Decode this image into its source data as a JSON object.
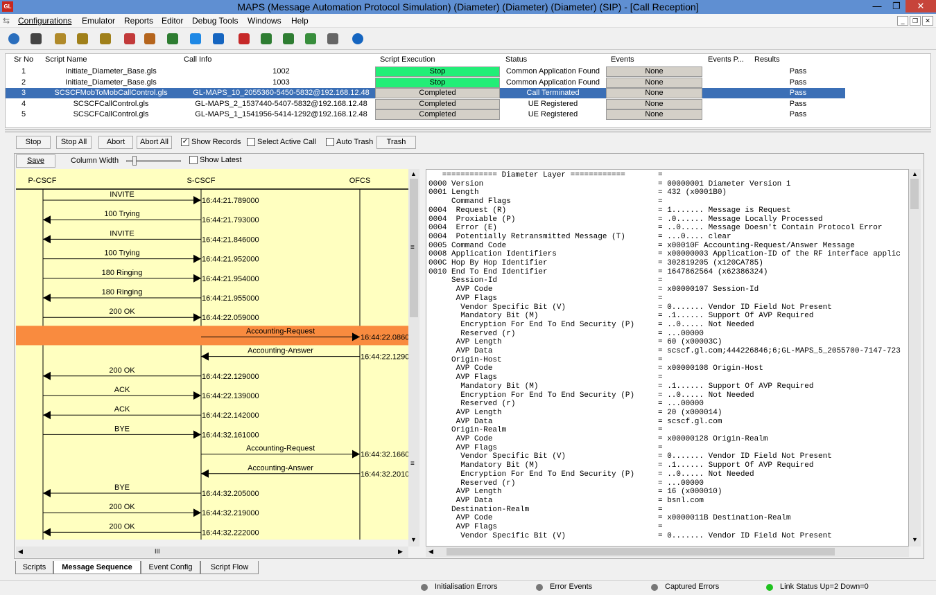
{
  "window": {
    "title": "MAPS (Message Automation Protocol Simulation) (Diameter) (Diameter) (Diameter) (SIP)  - [Call Reception]",
    "logo": "GL",
    "controls": {
      "minimize": "—",
      "restore": "❐",
      "close": "✕"
    }
  },
  "menu": [
    "Configurations",
    "Emulator",
    "Reports",
    "Editor",
    "Debug Tools",
    "Windows",
    "Help"
  ],
  "mdi_controls": [
    "_",
    "❐",
    "✕"
  ],
  "toolbar_icons": [
    "gear-icon",
    "log-icon",
    "script-icon",
    "profile-icon",
    "profile2-icon",
    "database-icon",
    "briefcase-icon",
    "user-icon",
    "edit-icon",
    "tools-icon",
    "stop-script-icon",
    "restart-icon",
    "pause-icon",
    "exchange-icon",
    "broom-icon",
    "help-icon"
  ],
  "grid": {
    "headers": [
      "Sr No",
      "Script Name",
      "Call Info",
      "Script Execution",
      "Status",
      "Events",
      "Events P...",
      "Results"
    ],
    "rows": [
      {
        "sr": "1",
        "script": "Initiate_Diameter_Base.gls",
        "call": "1002",
        "exec": "Stop",
        "exec_color": "#22ee77",
        "status": "Common Application Found",
        "events": "None",
        "result": "Pass"
      },
      {
        "sr": "2",
        "script": "Initiate_Diameter_Base.gls",
        "call": "1003",
        "exec": "Stop",
        "exec_color": "#22ee77",
        "status": "Common Application Found",
        "events": "None",
        "result": "Pass"
      },
      {
        "sr": "3",
        "script": "SCSCFMobToMobCallControl.gls",
        "call": "GL-MAPS_10_2055360-5450-5832@192.168.12.48",
        "exec": "Completed",
        "exec_color": "#d4d0c8",
        "status": "Call Terminated",
        "events": "None",
        "result": "Pass"
      },
      {
        "sr": "4",
        "script": "SCSCFCallControl.gls",
        "call": "GL-MAPS_2_1537440-5407-5832@192.168.12.48",
        "exec": "Completed",
        "exec_color": "#d4d0c8",
        "status": "UE Registered",
        "events": "None",
        "result": "Pass"
      },
      {
        "sr": "5",
        "script": "SCSCFCallControl.gls",
        "call": "GL-MAPS_1_1541956-5414-1292@192.168.12.48",
        "exec": "Completed",
        "exec_color": "#d4d0c8",
        "status": "UE Registered",
        "events": "None",
        "result": "Pass"
      }
    ]
  },
  "controls": {
    "stop": "Stop",
    "stop_all": "Stop All",
    "abort": "Abort",
    "abort_all": "Abort All",
    "show_records": "Show Records",
    "select_active_call": "Select Active Call",
    "auto_trash": "Auto Trash",
    "trash": "Trash",
    "save": "Save",
    "column_width": "Column Width",
    "show_latest": "Show Latest",
    "check_mark": "✓"
  },
  "sequence": {
    "entities": [
      "P-CSCF",
      "S-CSCF",
      "OFCS"
    ],
    "messages": [
      {
        "label": "INVITE",
        "dir": "r",
        "from": 0,
        "to": 1,
        "time": "16:44:21.789000"
      },
      {
        "label": "100  Trying",
        "dir": "l",
        "from": 1,
        "to": 0,
        "time": "16:44:21.793000"
      },
      {
        "label": "INVITE",
        "dir": "l",
        "from": 1,
        "to": 0,
        "time": "16:44:21.846000"
      },
      {
        "label": "100  Trying",
        "dir": "r",
        "from": 0,
        "to": 1,
        "time": "16:44:21.952000"
      },
      {
        "label": "180  Ringing",
        "dir": "r",
        "from": 0,
        "to": 1,
        "time": "16:44:21.954000"
      },
      {
        "label": "180  Ringing",
        "dir": "l",
        "from": 1,
        "to": 0,
        "time": "16:44:21.955000"
      },
      {
        "label": "200  OK",
        "dir": "r",
        "from": 0,
        "to": 1,
        "time": "16:44:22.059000"
      },
      {
        "label": "Accounting-Request",
        "dir": "r",
        "from": 1,
        "to": 2,
        "time": "16:44:22.0860",
        "highlight": true
      },
      {
        "label": "Accounting-Answer",
        "dir": "l",
        "from": 2,
        "to": 1,
        "time": "16:44:22.1290"
      },
      {
        "label": "200  OK",
        "dir": "l",
        "from": 1,
        "to": 0,
        "time": "16:44:22.129000"
      },
      {
        "label": "ACK",
        "dir": "r",
        "from": 0,
        "to": 1,
        "time": "16:44:22.139000"
      },
      {
        "label": "ACK",
        "dir": "l",
        "from": 1,
        "to": 0,
        "time": "16:44:22.142000"
      },
      {
        "label": "BYE",
        "dir": "r",
        "from": 0,
        "to": 1,
        "time": "16:44:32.161000"
      },
      {
        "label": "Accounting-Request",
        "dir": "r",
        "from": 1,
        "to": 2,
        "time": "16:44:32.1660"
      },
      {
        "label": "Accounting-Answer",
        "dir": "l",
        "from": 2,
        "to": 1,
        "time": "16:44:32.2010"
      },
      {
        "label": "BYE",
        "dir": "l",
        "from": 1,
        "to": 0,
        "time": "16:44:32.205000"
      },
      {
        "label": "200  OK",
        "dir": "r",
        "from": 0,
        "to": 1,
        "time": "16:44:32.219000"
      },
      {
        "label": "200  OK",
        "dir": "l",
        "from": 1,
        "to": 0,
        "time": "16:44:32.222000"
      }
    ],
    "highlight_color": "#f98b3f"
  },
  "decode": [
    [
      "   ============ Diameter Layer ============",
      "= "
    ],
    [
      "0000 Version",
      "= 00000001 Diameter Version 1"
    ],
    [
      "0001 Length",
      "= 432 (x0001B0)"
    ],
    [
      "     Command Flags",
      "="
    ],
    [
      "0004  Request (R)",
      "= 1....... Message is Request"
    ],
    [
      "0004  Proxiable (P)",
      "= .0...... Message Locally Processed"
    ],
    [
      "0004  Error (E)",
      "= ..0..... Message Doesn't Contain Protocol Error"
    ],
    [
      "0004  Potentially Retransmitted Message (T)",
      "= ...0.... clear"
    ],
    [
      "0005 Command Code",
      "= x00010F Accounting-Request/Answer Message"
    ],
    [
      "0008 Application Identifiers",
      "= x00000003 Application-ID of the RF interface applic"
    ],
    [
      "000C Hop By Hop Identifier",
      "= 302819205 (x120CA785)"
    ],
    [
      "0010 End To End Identifier",
      "= 1647862564 (x62386324)"
    ],
    [
      "     Session-Id",
      "="
    ],
    [
      "      AVP Code",
      "= x00000107 Session-Id"
    ],
    [
      "      AVP Flags",
      "="
    ],
    [
      "       Vendor Specific Bit (V)",
      "= 0....... Vendor ID Field Not Present"
    ],
    [
      "       Mandatory Bit (M)",
      "= .1...... Support Of AVP Required"
    ],
    [
      "       Encryption For End To End Security (P)",
      "= ..0..... Not Needed"
    ],
    [
      "       Reserved (r)",
      "= ...00000"
    ],
    [
      "      AVP Length",
      "= 60 (x00003C)"
    ],
    [
      "      AVP Data",
      "= scscf.gl.com;444226846;6;GL-MAPS_5_2055700-7147-723"
    ],
    [
      "     Origin-Host",
      "="
    ],
    [
      "      AVP Code",
      "= x00000108 Origin-Host"
    ],
    [
      "      AVP Flags",
      "="
    ],
    [
      "       Mandatory Bit (M)",
      "= .1...... Support Of AVP Required"
    ],
    [
      "       Encryption For End To End Security (P)",
      "= ..0..... Not Needed"
    ],
    [
      "       Reserved (r)",
      "= ...00000"
    ],
    [
      "      AVP Length",
      "= 20 (x000014)"
    ],
    [
      "      AVP Data",
      "= scscf.gl.com"
    ],
    [
      "     Origin-Realm",
      "="
    ],
    [
      "      AVP Code",
      "= x00000128 Origin-Realm"
    ],
    [
      "      AVP Flags",
      "="
    ],
    [
      "       Vendor Specific Bit (V)",
      "= 0....... Vendor ID Field Not Present"
    ],
    [
      "       Mandatory Bit (M)",
      "= .1...... Support Of AVP Required"
    ],
    [
      "       Encryption For End To End Security (P)",
      "= ..0..... Not Needed"
    ],
    [
      "       Reserved (r)",
      "= ...00000"
    ],
    [
      "      AVP Length",
      "= 16 (x000010)"
    ],
    [
      "      AVP Data",
      "= bsnl.com"
    ],
    [
      "     Destination-Realm",
      "="
    ],
    [
      "      AVP Code",
      "= x0000011B Destination-Realm"
    ],
    [
      "      AVP Flags",
      "="
    ],
    [
      "       Vendor Specific Bit (V)",
      "= 0....... Vendor ID Field Not Present"
    ]
  ],
  "tabs": [
    "Scripts",
    "Message Sequence",
    "Event Config",
    "Script Flow"
  ],
  "active_tab": 1,
  "status": {
    "init_errors": "Initialisation Errors",
    "error_events": "Error Events",
    "captured_errors": "Captured Errors",
    "link_status": "Link Status Up=2 Down=0"
  },
  "scroll_glyphs": {
    "up": "▲",
    "down": "▼",
    "left": "◀",
    "right": "▶",
    "grip": "≡",
    "hgrip": "III"
  }
}
